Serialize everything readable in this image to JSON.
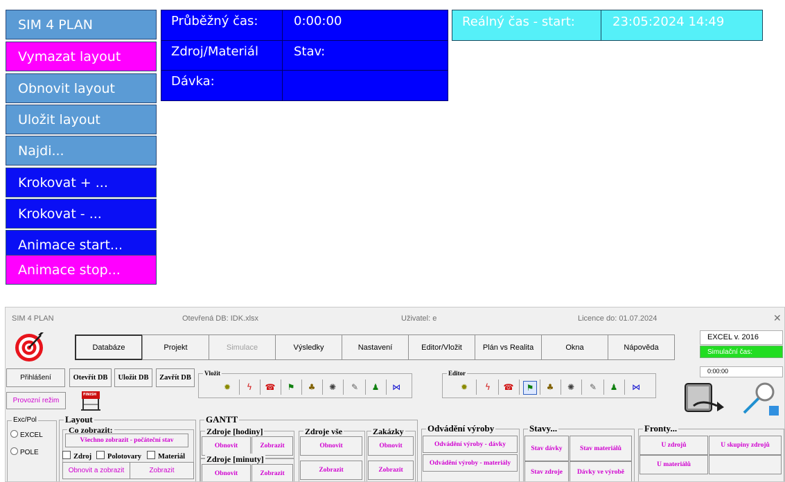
{
  "left_buttons": [
    {
      "label": "SIM 4 PLAN"
    },
    {
      "label": "Vymazat layout"
    },
    {
      "label": "Obnovit layout"
    },
    {
      "label": "Uložit layout"
    },
    {
      "label": "Najdi..."
    },
    {
      "label": "Krokovat + ..."
    },
    {
      "label": "Krokovat - ..."
    },
    {
      "label": "Animace start..."
    },
    {
      "label": "Animace stop..."
    }
  ],
  "info_table": {
    "running_time_label": "Průběžný čas:",
    "running_time_value": "0:00:00",
    "resource_label": "Zdroj/Materiál",
    "state_label": "Stav:",
    "batch_label": "Dávka:"
  },
  "real_time": {
    "label": "Reálný čas - start:",
    "value": "23:05:2024 14:49"
  },
  "panel": {
    "app_name": "SIM 4 PLAN",
    "db_info": "Otevřená DB:  IDK.xlsx",
    "user_info": "Uživatel:  e",
    "license_info": "Licence do: 01.07.2024",
    "close_glyph": "✕",
    "menu": [
      {
        "label": "Databáze"
      },
      {
        "label": "Projekt"
      },
      {
        "label": "Simulace"
      },
      {
        "label": "Výsledky"
      },
      {
        "label": "Nastavení"
      },
      {
        "label": "Editor/Vložit"
      },
      {
        "label": "Plán vs Realita"
      },
      {
        "label": "Okna"
      },
      {
        "label": "Nápověda"
      }
    ],
    "excel_version": "EXCEL v.  2016",
    "sim_time_label": "Simulační čas:",
    "sim_time_value": "0:00:00",
    "login_button": "Přihlášení",
    "open_db": "Otevřít DB",
    "save_db": "Uložit DB",
    "close_db": "Zavřít DB",
    "operating_mode": "Provozní režim",
    "finish_label": "FINISH",
    "insert_group": "Vložit",
    "editor_group": "Editor",
    "exc_group": "Exc/Pol",
    "radio_excel": "EXCEL",
    "radio_pole": "POLE",
    "layout_group": "Layout",
    "what_show_group": "Co zobrazit:",
    "show_all": "Všechno zobrazit - počáteční stav",
    "chk_zdroj": "Zdroj",
    "chk_polotovary": "Polotovary",
    "chk_material": "Materiál",
    "refresh_show": "Obnovit a zobrazit",
    "show": "Zobrazit",
    "gantt_group": "GANTT",
    "res_hours_group": "Zdroje [hodiny]",
    "res_minutes_group": "Zdroje [minuty]",
    "res_all_group": "Zdroje vše",
    "orders_group": "Zakázky",
    "btn_refresh": "Obnovit",
    "btn_show": "Zobrazit",
    "dispatch_group": "Odvádění výroby",
    "dispatch_batches": "Odvádění výroby - dávky",
    "dispatch_materials": "Odvádění výroby - materiály",
    "states_group": "Stavy...",
    "state_batch": "Stav dávky",
    "state_material": "Stav materiálů",
    "state_resource": "Stav zdroje",
    "batches_in_production": "Dávky ve výrobě",
    "queues_group": "Fronty...",
    "at_resources": "U zdrojů",
    "at_resource_groups": "U skupiny zdrojů",
    "at_materials": "U materiálů"
  },
  "colors": {
    "light_blue": "#5b9bd5",
    "blue": "#0000ff",
    "magenta": "#ff00ff",
    "cyan": "#55f0f8",
    "green": "#22dd22"
  }
}
